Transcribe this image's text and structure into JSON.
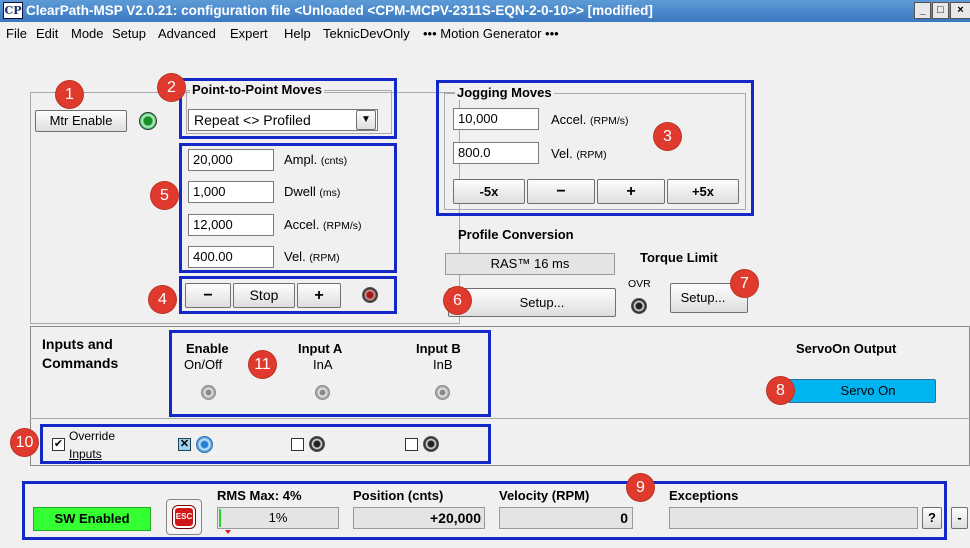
{
  "window": {
    "logo": "CP",
    "title": "ClearPath-MSP V2.0.21:  configuration file <Unloaded <CPM-MCPV-2311S-EQN-2-0-10>> [modified]",
    "buttons": {
      "minimize": "_",
      "maximize": "□",
      "close": "×"
    }
  },
  "menu": [
    "File",
    "Edit",
    "Mode",
    "Setup",
    "Advanced",
    "Expert",
    "Help",
    "TeknicDevOnly",
    "••• Motion Generator •••"
  ],
  "badges": [
    "1",
    "2",
    "3",
    "4",
    "5",
    "6",
    "7",
    "8",
    "9",
    "10",
    "11"
  ],
  "motor": {
    "enable_label": "Mtr Enable",
    "led_state": "on"
  },
  "p2p": {
    "title": "Point-to-Point Moves",
    "mode": "Repeat <> Profiled",
    "dropdown_arrow": "▼",
    "rows": [
      {
        "value": "20,000",
        "label": "Ampl.",
        "unit": "(cnts)"
      },
      {
        "value": "1,000",
        "label": "Dwell",
        "unit": "(ms)"
      },
      {
        "value": "12,000",
        "label": "Accel.",
        "unit": "(RPM/s)"
      },
      {
        "value": "400.00",
        "label": "Vel.",
        "unit": "(RPM)"
      }
    ],
    "minus": "−",
    "stop": "Stop",
    "plus": "+"
  },
  "jog": {
    "title": "Jogging Moves",
    "accel_value": "10,000",
    "accel_label": "Accel.",
    "accel_unit": "(RPM/s)",
    "vel_value": "800.0",
    "vel_label": "Vel.",
    "vel_unit": "(RPM)",
    "buttons": [
      "-5x",
      "−",
      "+",
      "+5x"
    ]
  },
  "profile": {
    "title": "Profile Conversion",
    "value": "RAS™ 16 ms",
    "setup": "Setup..."
  },
  "torque": {
    "title": "Torque Limit",
    "ovr": "OVR",
    "setup": "Setup..."
  },
  "inputs": {
    "title_line1": "Inputs and",
    "title_line2": "Commands",
    "enable": {
      "title": "Enable",
      "sub": "On/Off"
    },
    "input_a": {
      "title": "Input A",
      "sub": "InA"
    },
    "input_b": {
      "title": "Input B",
      "sub": "InB"
    },
    "override_line1": "Override",
    "override_line2": "Inputs",
    "override_checked": "✔",
    "enable_checked": "✕",
    "servo_title": "ServoOn Output",
    "servo_button": "Servo On"
  },
  "status": {
    "sw_enabled": "SW Enabled",
    "esc": "ESC",
    "rms_label": "RMS Max: 4%",
    "rms_value": "1%",
    "rms_fraction": 0.01,
    "position_label": "Position (cnts)",
    "position_value": "+20,000",
    "velocity_label": "Velocity (RPM)",
    "velocity_value": "0",
    "exceptions_label": "Exceptions",
    "exceptions_value": "",
    "help": "?",
    "minimize": "-"
  },
  "colors": {
    "accent_blue": "#1428c8",
    "badge_red": "#e03a2e",
    "servo_cyan": "#00b4f0",
    "sw_green": "#33ff33"
  }
}
